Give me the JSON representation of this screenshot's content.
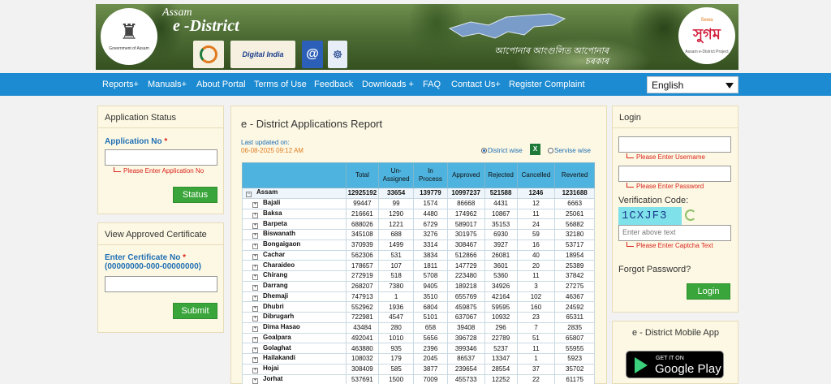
{
  "banner": {
    "state": "Assam",
    "brand": "e -District",
    "emblem_caption": "Government of Assam",
    "digital_india": "Digital India",
    "tagline": "আপোনাৰ আংগুলিত আপোনাৰ চৰকাৰ",
    "sugam_top": "Sewa",
    "sugam_name": "সুগম",
    "sugam_caption": "Assam e-District Project"
  },
  "nav": {
    "items": [
      "Reports+",
      "Manuals+",
      "About Portal",
      "Terms of Use",
      "Feedback",
      "Downloads +",
      "FAQ",
      "Contact Us+",
      "Register Complaint"
    ],
    "language": "English"
  },
  "application_status": {
    "title": "Application Status",
    "label": "Application No",
    "required": "*",
    "error": "Please Enter Application No",
    "button": "Status"
  },
  "approved_certificate": {
    "title": "View Approved Certificate",
    "label": "Enter Certificate No",
    "required": "*",
    "format": "(00000000-000-00000000)",
    "button": "Submit"
  },
  "report": {
    "title": "e - District Applications Report",
    "updated_label": "Last updated on:",
    "updated_value": "06-08-2025 09:12 AM",
    "radio_district": "District wise",
    "radio_service": "Servise wise",
    "headers": [
      "",
      "Total",
      "Un-Assigned",
      "In Process",
      "Approved",
      "Rejected",
      "Cancelled",
      "Reverted"
    ],
    "state": {
      "name": "Assam",
      "values": [
        "12925192",
        "33654",
        "139779",
        "10997237",
        "521588",
        "1246",
        "1231688"
      ]
    },
    "rows": [
      {
        "name": "Bajali",
        "values": [
          "99447",
          "99",
          "1574",
          "86668",
          "4431",
          "12",
          "6663"
        ]
      },
      {
        "name": "Baksa",
        "values": [
          "216661",
          "1290",
          "4480",
          "174962",
          "10867",
          "11",
          "25061"
        ]
      },
      {
        "name": "Barpeta",
        "values": [
          "688026",
          "1221",
          "6729",
          "589017",
          "35153",
          "24",
          "56882"
        ]
      },
      {
        "name": "Biswanath",
        "values": [
          "345108",
          "688",
          "3276",
          "301975",
          "6930",
          "59",
          "32180"
        ]
      },
      {
        "name": "Bongaigaon",
        "values": [
          "370939",
          "1499",
          "3314",
          "308467",
          "3927",
          "16",
          "53717"
        ]
      },
      {
        "name": "Cachar",
        "values": [
          "562306",
          "531",
          "3834",
          "512866",
          "26081",
          "40",
          "18954"
        ]
      },
      {
        "name": "Charaideo",
        "values": [
          "178657",
          "107",
          "1811",
          "147729",
          "3601",
          "20",
          "25389"
        ]
      },
      {
        "name": "Chirang",
        "values": [
          "272919",
          "518",
          "5708",
          "223480",
          "5360",
          "11",
          "37842"
        ]
      },
      {
        "name": "Darrang",
        "values": [
          "268207",
          "7380",
          "9405",
          "189218",
          "34926",
          "3",
          "27275"
        ]
      },
      {
        "name": "Dhemaji",
        "values": [
          "747913",
          "1",
          "3510",
          "655769",
          "42164",
          "102",
          "46367"
        ]
      },
      {
        "name": "Dhubri",
        "values": [
          "552962",
          "1936",
          "6804",
          "459875",
          "59595",
          "160",
          "24592"
        ]
      },
      {
        "name": "Dibrugarh",
        "values": [
          "722981",
          "4547",
          "5101",
          "637067",
          "10932",
          "23",
          "65311"
        ]
      },
      {
        "name": "Dima Hasao",
        "values": [
          "43484",
          "280",
          "658",
          "39408",
          "296",
          "7",
          "2835"
        ]
      },
      {
        "name": "Goalpara",
        "values": [
          "492041",
          "1010",
          "5656",
          "396728",
          "22789",
          "51",
          "65807"
        ]
      },
      {
        "name": "Golaghat",
        "values": [
          "463880",
          "935",
          "2396",
          "399346",
          "5237",
          "11",
          "55955"
        ]
      },
      {
        "name": "Hailakandi",
        "values": [
          "108032",
          "179",
          "2045",
          "86537",
          "13347",
          "1",
          "5923"
        ]
      },
      {
        "name": "Hojai",
        "values": [
          "308409",
          "585",
          "3877",
          "239654",
          "28554",
          "37",
          "35702"
        ]
      },
      {
        "name": "Jorhat",
        "values": [
          "537691",
          "1500",
          "7009",
          "455733",
          "12252",
          "22",
          "61175"
        ]
      }
    ]
  },
  "login": {
    "title": "Login",
    "username_error": "Please Enter Username",
    "password_error": "Please Enter Password",
    "verification_label": "Verification Code:",
    "captcha": "1CXJF3",
    "captcha_placeholder": "Enter above text",
    "captcha_error": "Please Enter Captcha Text",
    "forgot": "Forgot Password?",
    "button": "Login"
  },
  "mobile_app": {
    "title": "e - District Mobile App",
    "store_small": "GET IT ON",
    "store_big": "Google Play"
  }
}
